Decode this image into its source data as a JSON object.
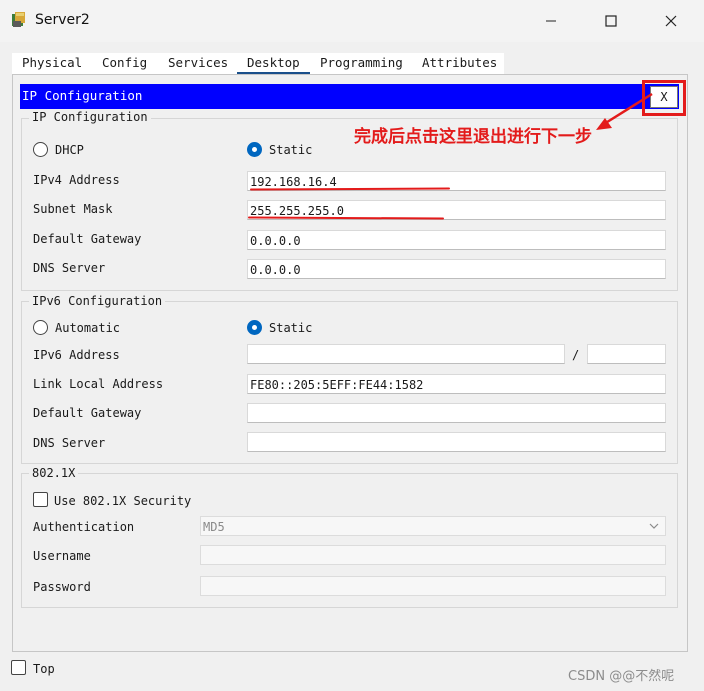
{
  "window": {
    "title": "Server2"
  },
  "tabs": [
    "Physical",
    "Config",
    "Services",
    "Desktop",
    "Programming",
    "Attributes"
  ],
  "active_tab": "Desktop",
  "ip_config": {
    "header": "IP Configuration",
    "close_label": "X",
    "ipv4": {
      "legend": "IP Configuration",
      "dhcp_label": "DHCP",
      "static_label": "Static",
      "mode": "Static",
      "ipv4_address_label": "IPv4 Address",
      "ipv4_address": "192.168.16.4",
      "subnet_mask_label": "Subnet Mask",
      "subnet_mask": "255.255.255.0",
      "gateway_label": "Default Gateway",
      "gateway": "0.0.0.0",
      "dns_label": "DNS Server",
      "dns": "0.0.0.0"
    },
    "ipv6": {
      "legend": "IPv6 Configuration",
      "automatic_label": "Automatic",
      "static_label": "Static",
      "mode": "Static",
      "ipv6_address_label": "IPv6 Address",
      "ipv6_address": "",
      "prefix_separator": "/",
      "prefix": "",
      "link_local_label": "Link Local Address",
      "link_local": "FE80::205:5EFF:FE44:1582",
      "gateway_label": "Default Gateway",
      "gateway": "",
      "dns_label": "DNS Server",
      "dns": ""
    },
    "dot1x": {
      "legend": "802.1X",
      "use_label": "Use 802.1X Security",
      "use_checked": false,
      "auth_label": "Authentication",
      "auth_value": "MD5",
      "username_label": "Username",
      "username": "",
      "password_label": "Password",
      "password": ""
    }
  },
  "annotation": "完成后点击这里退出进行下一步",
  "footer": {
    "top_label": "Top",
    "top_checked": false
  },
  "watermark": "CSDN @@不然呢",
  "colors": {
    "header_blue": "#0000ff",
    "annotation_red": "#e31b1b",
    "radio_blue": "#0067c0"
  }
}
